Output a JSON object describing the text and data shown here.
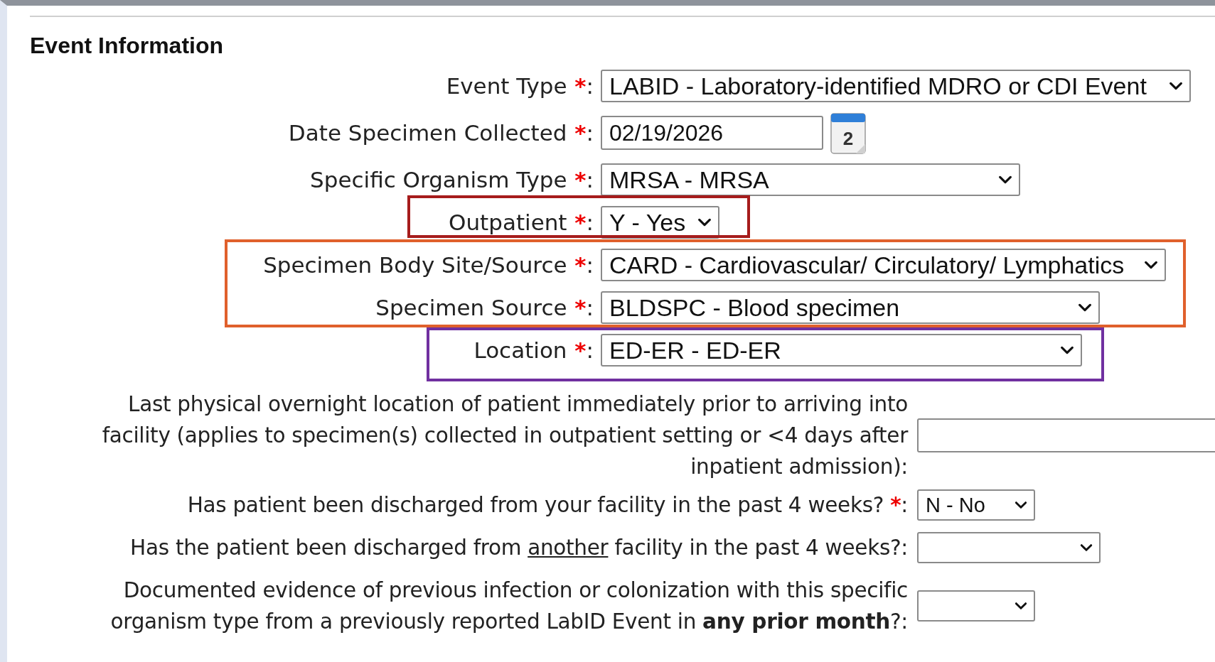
{
  "section": {
    "title": "Event Information"
  },
  "groups": [
    {
      "fields": [
        {
          "kind": "select",
          "label": "Event Type",
          "mark": "*",
          "colon": ":",
          "value": "LABID - Laboratory-identified MDRO or CDI Event"
        },
        {
          "kind": "date",
          "label": "Date Specimen Collected",
          "mark": "*",
          "colon": ":",
          "value": "02/19/2026",
          "calendar_day": "2"
        },
        {
          "kind": "select",
          "label": "Specific Organism Type",
          "mark": "*",
          "colon": ":",
          "value": "MRSA - MRSA"
        }
      ]
    },
    {
      "color": "#a61c1c",
      "fields": [
        {
          "kind": "select",
          "label": "Outpatient",
          "mark": "*",
          "colon": ":",
          "value": "Y - Yes"
        }
      ]
    },
    {
      "color": "#e0602c",
      "fields": [
        {
          "kind": "select",
          "label": "Specimen Body Site/Source",
          "mark": "*",
          "colon": ":",
          "value": "CARD - Cardiovascular/ Circulatory/ Lymphatics"
        },
        {
          "kind": "select",
          "label": "Specimen Source",
          "mark": "*",
          "colon": ":",
          "value": "BLDSPC - Blood specimen"
        }
      ]
    },
    {
      "color": "#7030a0",
      "fields": [
        {
          "kind": "select",
          "label": "Location",
          "mark": "*",
          "colon": ":",
          "value": "ED-ER - ED-ER"
        }
      ]
    }
  ],
  "questions": [
    {
      "kind": "text",
      "label": "Last physical overnight location of patient immediately prior to arriving into\nfacility (applies to specimen(s) collected in outpatient setting or <4 days after\ninpatient admission):"
    },
    {
      "kind": "select",
      "label": "Has patient been discharged from your facility in the past 4 weeks? ",
      "mark": "*",
      "colon": ":",
      "value": "N - No"
    },
    {
      "kind": "select",
      "label_parts": [
        {
          "kind": "plain",
          "text": "Has the patient been discharged from "
        },
        {
          "kind": "underline",
          "text": "another"
        },
        {
          "kind": "plain",
          "text": " facility in the past 4 weeks?:"
        }
      ]
    },
    {
      "kind": "select",
      "label": "Documented evidence of previous infection or colonization with this specific\norganism type from a previously reported LabID Event in **any prior month**?:"
    }
  ]
}
